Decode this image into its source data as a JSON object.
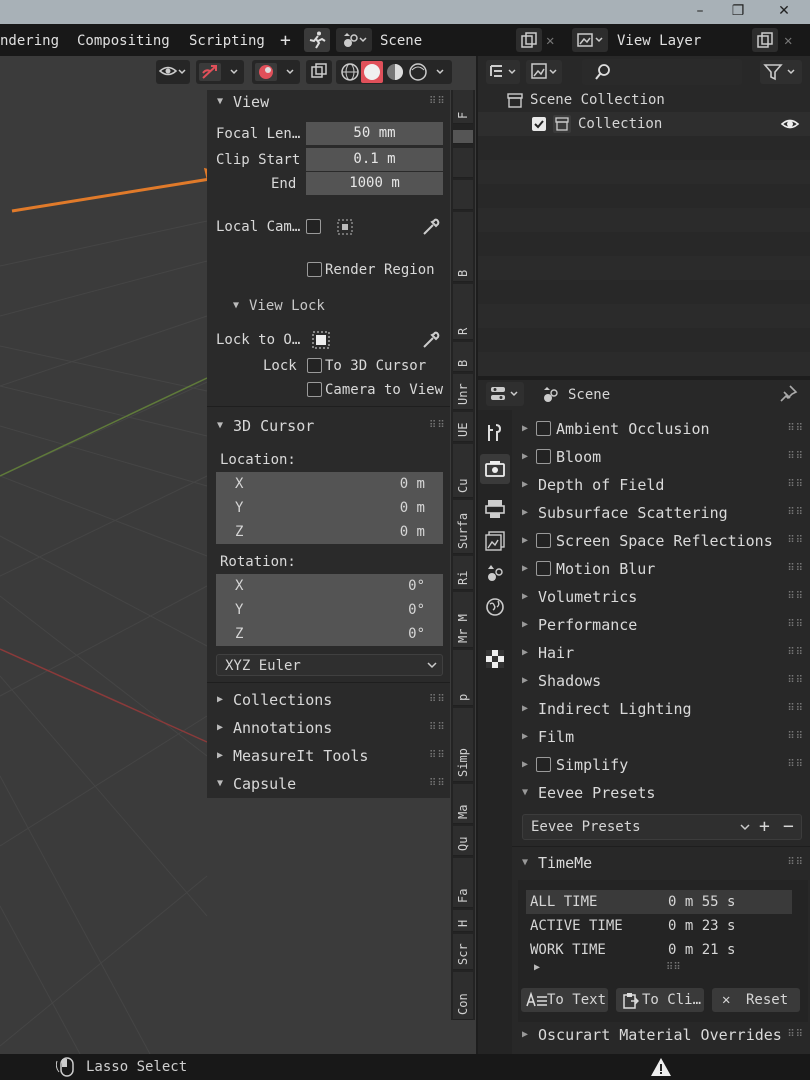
{
  "titlebar": {
    "minimize": "–",
    "maximize": "❐",
    "close": "✕"
  },
  "workspaces": {
    "rendering": "ndering",
    "compositing": "Compositing",
    "scripting": "Scripting",
    "add": "+"
  },
  "scene_selector": {
    "label": "Scene"
  },
  "view_layer_selector": {
    "label": "View Layer"
  },
  "npanel": {
    "view": {
      "header": "View",
      "focal_length_label": "Focal Len…",
      "focal_length_value": "50 mm",
      "clip_start_label": "Clip Start",
      "clip_start_value": "0.1 m",
      "clip_end_label": "End",
      "clip_end_value": "1000 m",
      "local_camera_label": "Local Cam…",
      "render_region_label": "Render Region",
      "view_lock_header": "View Lock",
      "lock_to_object_label": "Lock to O…",
      "lock_label": "Lock",
      "to_3d_cursor_label": "To 3D Cursor",
      "camera_to_view_label": "Camera to View"
    },
    "cursor": {
      "header": "3D Cursor",
      "location_label": "Location:",
      "location": [
        {
          "axis": "X",
          "value": "0 m"
        },
        {
          "axis": "Y",
          "value": "0 m"
        },
        {
          "axis": "Z",
          "value": "0 m"
        }
      ],
      "rotation_label": "Rotation:",
      "rotation": [
        {
          "axis": "X",
          "value": "0°"
        },
        {
          "axis": "Y",
          "value": "0°"
        },
        {
          "axis": "Z",
          "value": "0°"
        }
      ],
      "rotation_mode": "XYZ Euler"
    },
    "collapsed": [
      "Collections",
      "Annotations",
      "MeasureIt Tools"
    ],
    "capsule": "Capsule"
  },
  "vertical_tabs": [
    "F",
    "B",
    "R",
    "B",
    "Unr",
    "UE",
    "Cu",
    "Surfa",
    "Ri",
    "Mr M",
    "p",
    "Simp",
    "Ma",
    "Qu",
    "Fa",
    "H",
    "Scr",
    "Con"
  ],
  "outliner": {
    "scene_collection": "Scene Collection",
    "collection": "Collection"
  },
  "properties": {
    "scene_label": "Scene",
    "items": [
      {
        "label": "Ambient Occlusion",
        "checkbox": true
      },
      {
        "label": "Bloom",
        "checkbox": true
      },
      {
        "label": "Depth of Field",
        "checkbox": false
      },
      {
        "label": "Subsurface Scattering",
        "checkbox": false
      },
      {
        "label": "Screen Space Reflections",
        "checkbox": true
      },
      {
        "label": "Motion Blur",
        "checkbox": true
      },
      {
        "label": "Volumetrics",
        "checkbox": false
      },
      {
        "label": "Performance",
        "checkbox": false
      },
      {
        "label": "Hair",
        "checkbox": false
      },
      {
        "label": "Shadows",
        "checkbox": false
      },
      {
        "label": "Indirect Lighting",
        "checkbox": false
      },
      {
        "label": "Film",
        "checkbox": false
      },
      {
        "label": "Simplify",
        "checkbox": true
      }
    ],
    "eevee_presets_header": "Eevee Presets",
    "eevee_presets_value": "Eevee Presets",
    "timeme_header": "TimeMe",
    "timeme_rows": [
      {
        "label": "ALL TIME",
        "value": "0 m 55 s"
      },
      {
        "label": "ACTIVE TIME",
        "value": "0 m 23 s"
      },
      {
        "label": "WORK TIME",
        "value": "0 m 21 s"
      }
    ],
    "to_text_button": "To Text",
    "to_clipboard_button": "To Cli…",
    "reset_button": "Reset",
    "oscurart_header": "Oscurart Material Overrides"
  },
  "statusbar": {
    "lasso_select": "Lasso Select"
  }
}
